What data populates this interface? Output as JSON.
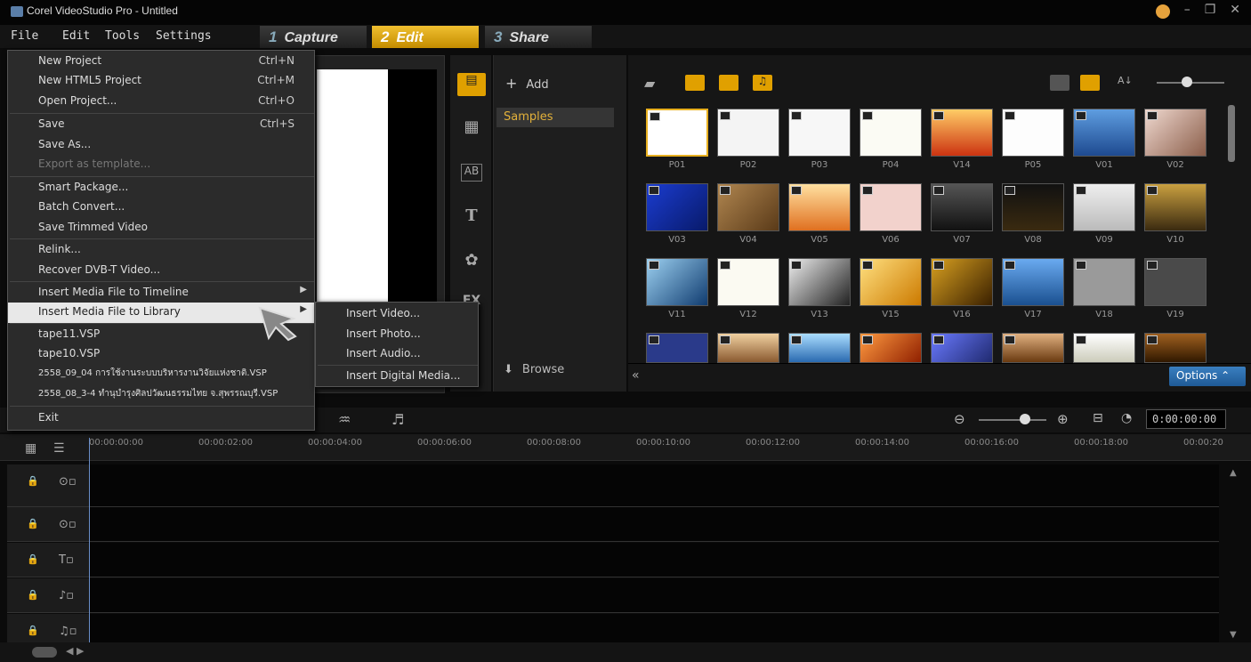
{
  "window": {
    "title": "Corel VideoStudio Pro - Untitled"
  },
  "menubar": {
    "items": [
      "File",
      "Edit",
      "Tools",
      "Settings"
    ]
  },
  "steps": [
    {
      "num": "1",
      "label": "Capture"
    },
    {
      "num": "2",
      "label": "Edit"
    },
    {
      "num": "3",
      "label": "Share"
    }
  ],
  "file_menu": {
    "new_project": "New Project",
    "new_project_sc": "Ctrl+N",
    "new_html5": "New HTML5 Project",
    "new_html5_sc": "Ctrl+M",
    "open_project": "Open Project...",
    "open_project_sc": "Ctrl+O",
    "save": "Save",
    "save_sc": "Ctrl+S",
    "save_as": "Save As...",
    "export_template": "Export as template...",
    "smart_package": "Smart Package...",
    "batch_convert": "Batch Convert...",
    "save_trimmed": "Save Trimmed Video",
    "relink": "Relink...",
    "recover": "Recover DVB-T Video...",
    "insert_timeline": "Insert Media File to Timeline",
    "insert_library": "Insert Media File to Library",
    "recent1": "tape11.VSP",
    "recent2": "tape10.VSP",
    "recent3": "2558_09_04 การใช้งานระบบบริหารงานวิจัยแห่งชาติ.VSP",
    "recent4": "2558_08_3-4 ทำนุบำรุงศิลปวัฒนธรรมไทย จ.สุพรรณบุรี.VSP",
    "exit": "Exit"
  },
  "submenu": {
    "video": "Insert Video...",
    "photo": "Insert Photo...",
    "audio": "Insert Audio...",
    "digital": "Insert Digital Media..."
  },
  "library": {
    "add": "Add",
    "folder": "Samples",
    "browse": "Browse",
    "options": "Options",
    "thumbs": [
      "P01",
      "P02",
      "P03",
      "P04",
      "V14",
      "P05",
      "V01",
      "V02",
      "V03",
      "V04",
      "V05",
      "V06",
      "V07",
      "V08",
      "V09",
      "V10",
      "V11",
      "V12",
      "V13",
      "V15",
      "V16",
      "V17",
      "V18",
      "V19"
    ]
  },
  "timeline": {
    "timecode": "0:00:00:00",
    "ticks": [
      "00:00:00:00",
      "00:00:02:00",
      "00:00:04:00",
      "00:00:06:00",
      "00:00:08:00",
      "00:00:10:00",
      "00:00:12:00",
      "00:00:14:00",
      "00:00:16:00",
      "00:00:18:00",
      "00:00:20"
    ]
  },
  "colors": {
    "accent": "#e8b020",
    "options_blue": "#2a6db0"
  }
}
